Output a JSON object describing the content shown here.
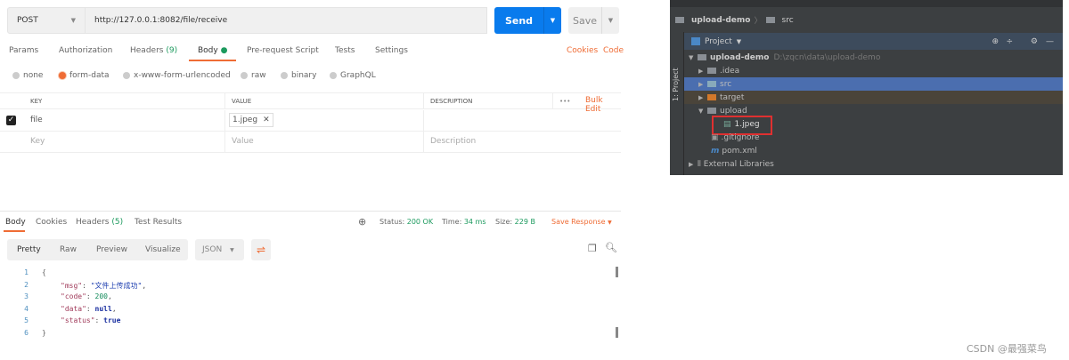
{
  "request": {
    "method": "POST",
    "url": "http://127.0.0.1:8082/file/receive",
    "send": "Send",
    "save": "Save"
  },
  "tabs": {
    "params": "Params",
    "authorization": "Authorization",
    "headers": "Headers",
    "headers_count": "(9)",
    "body": "Body",
    "prerequest": "Pre-request Script",
    "tests": "Tests",
    "settings": "Settings",
    "cookies": "Cookies",
    "code": "Code"
  },
  "body_types": [
    "none",
    "form-data",
    "x-www-form-urlencoded",
    "raw",
    "binary",
    "GraphQL"
  ],
  "table": {
    "headers": [
      "KEY",
      "VALUE",
      "DESCRIPTION"
    ],
    "bulk_edit": "Bulk Edit",
    "more": "•••",
    "rows": [
      {
        "key": "file",
        "value": "1.jpeg",
        "checked": true
      }
    ],
    "placeholder": {
      "key": "Key",
      "value": "Value",
      "description": "Description"
    }
  },
  "response": {
    "tabs": {
      "body": "Body",
      "cookies": "Cookies",
      "headers": "Headers",
      "headers_count": "(5)",
      "test_results": "Test Results"
    },
    "status_label": "Status:",
    "status": "200 OK",
    "time_label": "Time:",
    "time": "34 ms",
    "size_label": "Size:",
    "size": "229 B",
    "save_response": "Save Response",
    "views": [
      "Pretty",
      "Raw",
      "Preview",
      "Visualize"
    ],
    "format": "JSON",
    "lines": [
      "1",
      "2",
      "3",
      "4",
      "5",
      "6"
    ],
    "json": {
      "open": "{",
      "close": "}",
      "msg_key": "\"msg\"",
      "msg_val": "\"文件上传成功\"",
      "code_key": "\"code\"",
      "code_val": "200",
      "data_key": "\"data\"",
      "data_val": "null",
      "status_key": "\"status\"",
      "status_val": "true"
    }
  },
  "ide": {
    "breadcrumb": [
      "upload-demo",
      "src"
    ],
    "side_tab": "1: Project",
    "panel": "Project",
    "tree": {
      "root": "upload-demo",
      "root_path": "D:\\zqcn\\data\\upload-demo",
      "idea": ".idea",
      "src": "src",
      "target": "target",
      "upload": "upload",
      "file": "1.jpeg",
      "gitignore": ".gitignore",
      "pom": "pom.xml",
      "ext": "External Libraries"
    }
  },
  "watermark": "CSDN @最强菜鸟",
  "colors": {
    "accent": "#ef6c35",
    "send": "#097bed",
    "status_ok": "#1c9a5e",
    "ide_selected": "#4b6eaf",
    "highlight": "#e03030"
  }
}
